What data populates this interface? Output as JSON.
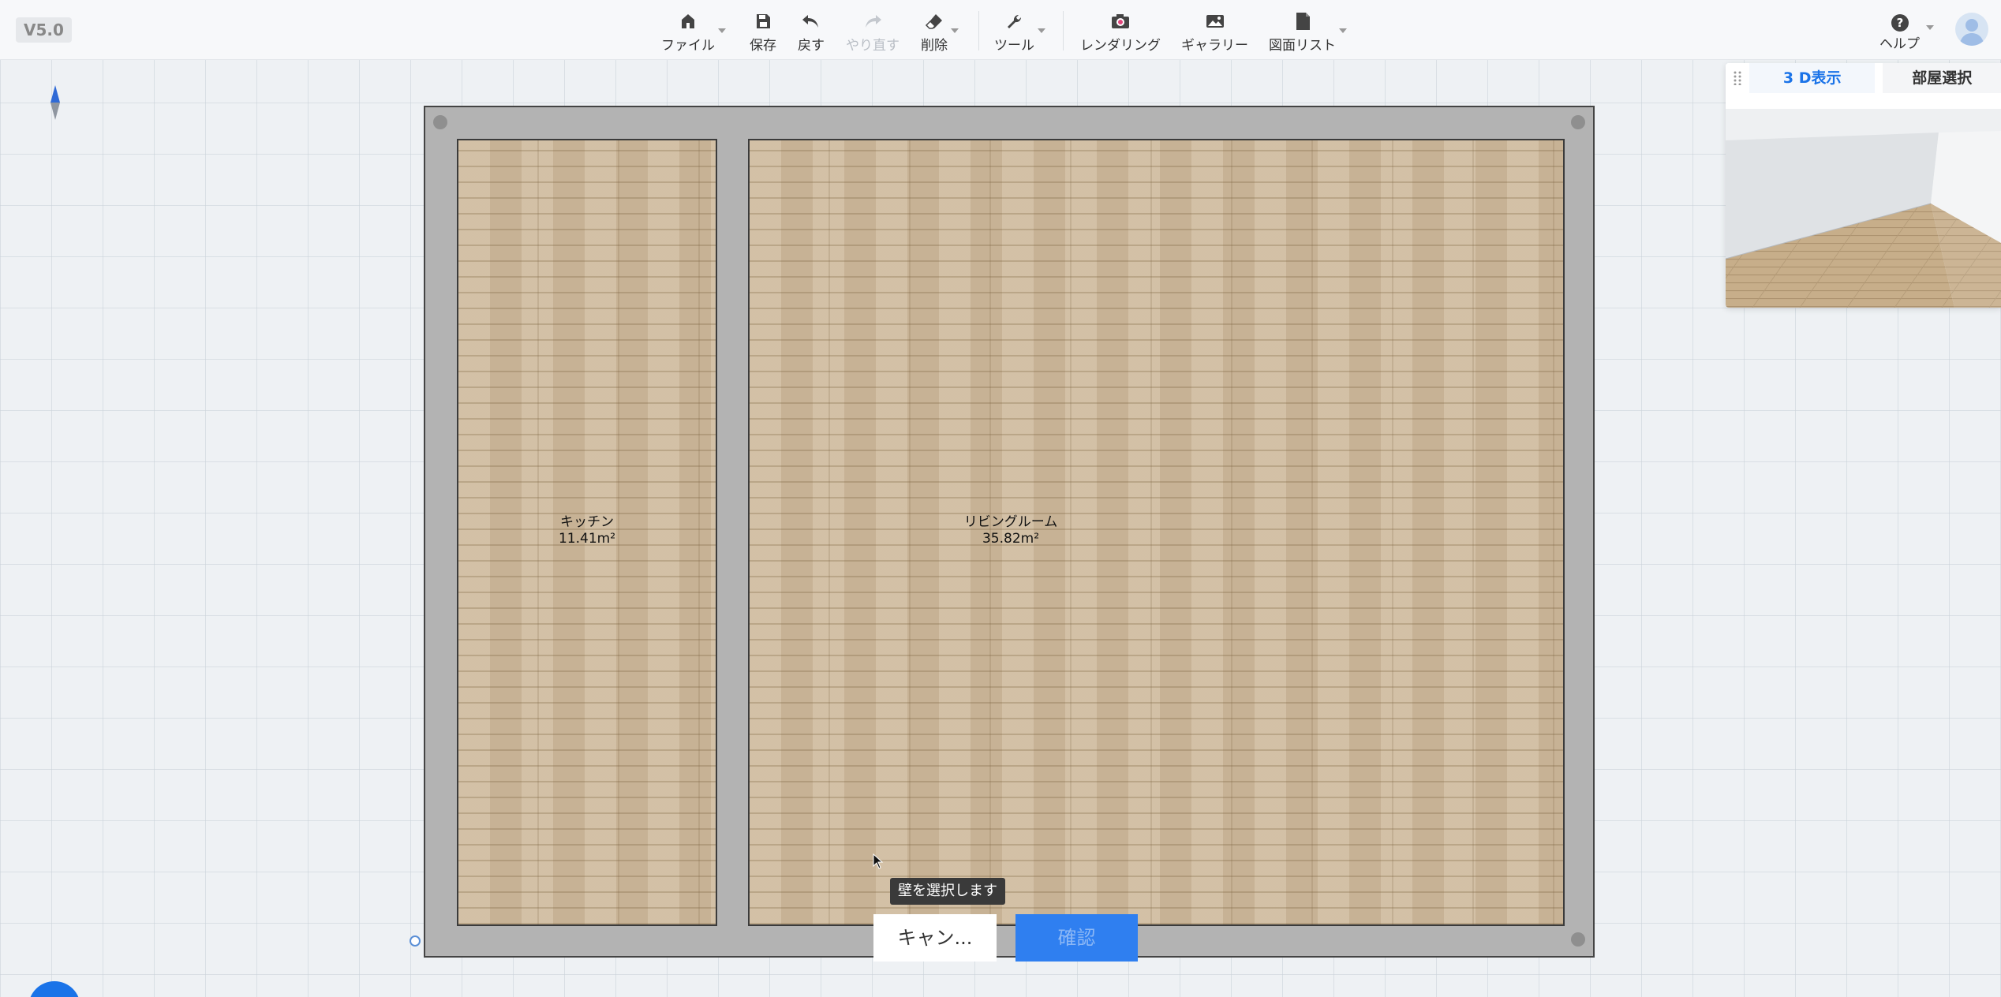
{
  "app": {
    "version": "V5.0"
  },
  "toolbar": {
    "items": [
      {
        "label": "ファイル",
        "icon": "home-icon",
        "has_dropdown": true
      },
      {
        "label": "保存",
        "icon": "save-icon"
      },
      {
        "label": "戻す",
        "icon": "undo-icon"
      },
      {
        "label": "やり直す",
        "icon": "redo-icon",
        "disabled": true
      },
      {
        "label": "削除",
        "icon": "eraser-icon",
        "has_dropdown": true
      },
      {
        "label": "ツール",
        "icon": "wrench-icon",
        "has_dropdown": true
      },
      {
        "label": "レンダリング",
        "icon": "camera-icon"
      },
      {
        "label": "ギャラリー",
        "icon": "image-icon"
      },
      {
        "label": "図面リスト",
        "icon": "document-icon",
        "has_dropdown": true
      }
    ],
    "help_label": "ヘルプ"
  },
  "plan": {
    "rooms": [
      {
        "name": "キッチン",
        "area": "11.41m²"
      },
      {
        "name": "リビングルーム",
        "area": "35.82m²"
      }
    ]
  },
  "hint": {
    "tooltip": "壁を選択します",
    "cancel_label": "キャン...",
    "confirm_label": "確認"
  },
  "panel3d": {
    "tabs": [
      {
        "label": "3 D表示",
        "active": true
      },
      {
        "label": "部屋選択",
        "active": false
      }
    ]
  },
  "colors": {
    "accent": "#1a73e8",
    "wall": "#b3b3b3",
    "floor": "#cdb89a",
    "tooltip_bg": "#3a3a3a"
  }
}
